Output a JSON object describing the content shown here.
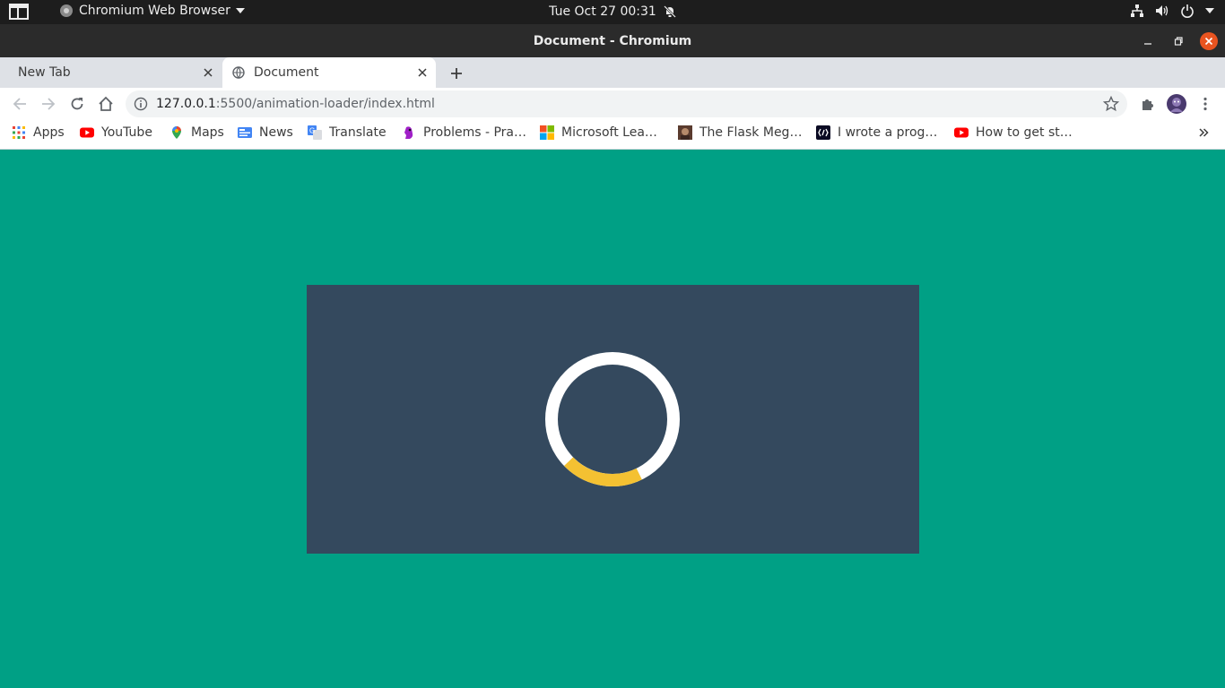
{
  "system_bar": {
    "app_name": "Chromium Web Browser",
    "clock": "Tue Oct 27  00:31"
  },
  "window": {
    "title": "Document - Chromium"
  },
  "tabs": [
    {
      "label": "New Tab",
      "active": false
    },
    {
      "label": "Document",
      "active": true
    }
  ],
  "address_bar": {
    "url_host": "127.0.0.1",
    "url_rest": ":5500/animation-loader/index.html"
  },
  "bookmarks": [
    {
      "label": "Apps",
      "icon": "apps-grid-icon"
    },
    {
      "label": "YouTube",
      "icon": "youtube-icon"
    },
    {
      "label": "Maps",
      "icon": "maps-pin-icon"
    },
    {
      "label": "News",
      "icon": "google-news-icon"
    },
    {
      "label": "Translate",
      "icon": "translate-icon"
    },
    {
      "label": "Problems - Pra…",
      "icon": "hackerrank-icon"
    },
    {
      "label": "Microsoft Lea…",
      "icon": "microsoft-icon"
    },
    {
      "label": "The Flask Meg…",
      "icon": "flask-avatar-icon"
    },
    {
      "label": "I wrote a prog…",
      "icon": "dev-icon"
    },
    {
      "label": "How to get st…",
      "icon": "youtube-icon"
    }
  ],
  "page": {
    "background_color": "#00a085",
    "panel_color": "#34495e",
    "spinner": {
      "ring_color": "#ffffff",
      "arc_color": "#f4c132",
      "arc_fraction": 0.2
    }
  }
}
